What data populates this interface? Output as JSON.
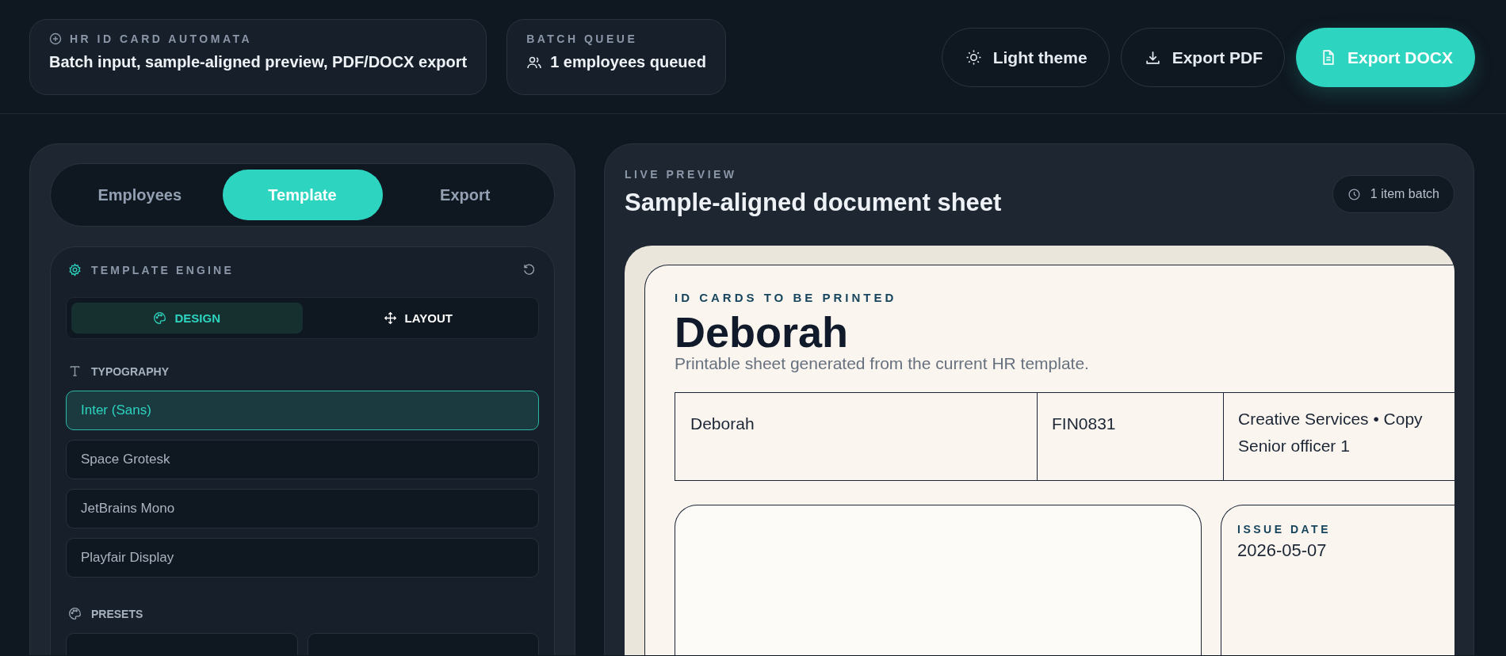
{
  "header": {
    "app_card": {
      "eyebrow": "HR ID CARD AUTOMATA",
      "text": "Batch input, sample-aligned preview, PDF/DOCX export"
    },
    "queue_card": {
      "eyebrow": "BATCH QUEUE",
      "text": "1 employees queued"
    }
  },
  "actions": [
    {
      "label": "Light theme",
      "kind": "theme",
      "primary": false
    },
    {
      "label": "Export PDF",
      "kind": "pdf",
      "primary": false
    },
    {
      "label": "Export DOCX",
      "kind": "docx",
      "primary": true
    }
  ],
  "tabs": [
    {
      "label": "Employees",
      "selected": false
    },
    {
      "label": "Template",
      "selected": true
    },
    {
      "label": "Export",
      "selected": false
    }
  ],
  "template_engine": {
    "title": "TEMPLATE ENGINE",
    "modes": [
      {
        "label": "DESIGN",
        "kind": "design",
        "selected": true
      },
      {
        "label": "LAYOUT",
        "kind": "layout",
        "selected": false
      }
    ],
    "typography": {
      "title": "TYPOGRAPHY",
      "fonts": [
        {
          "label": "Inter (Sans)",
          "selected": true
        },
        {
          "label": "Space Grotesk",
          "selected": false
        },
        {
          "label": "JetBrains Mono",
          "selected": false
        },
        {
          "label": "Playfair Display",
          "selected": false
        }
      ]
    },
    "presets": {
      "title": "PRESETS"
    }
  },
  "preview": {
    "eyebrow": "LIVE PREVIEW",
    "title": "Sample-aligned document sheet",
    "badge": "1 item batch",
    "sheet": {
      "eyebrow": "ID CARDS TO BE PRINTED",
      "name": "Deborah",
      "subtitle": "Printable sheet generated from the current HR template.",
      "table_cells": [
        "Deborah",
        "FIN0831",
        "Creative Services • Copy\nSenior officer 1"
      ],
      "issue_date": {
        "label": "ISSUE DATE",
        "value": "2026-05-07"
      }
    }
  }
}
